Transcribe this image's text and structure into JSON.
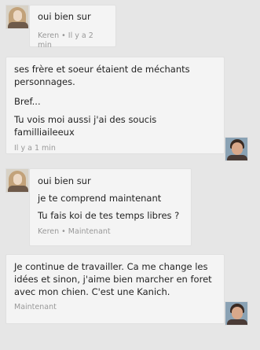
{
  "messages": [
    {
      "sender": "Keren",
      "lines": [
        "oui bien sur"
      ],
      "meta": "Keren • Il y a 2 min",
      "avatar_icon": "keren-avatar-icon"
    },
    {
      "sender": "me",
      "lines": [
        "ses frère et soeur étaient de méchants personnages.",
        "Bref...",
        "Tu vois moi aussi j'ai des soucis familliaileeux"
      ],
      "meta": "Il y a 1 min",
      "avatar_icon": "user-avatar-icon"
    },
    {
      "sender": "Keren",
      "lines": [
        "oui bien sur",
        "je te comprend maintenant",
        "Tu fais koi de tes temps libres ?"
      ],
      "meta": "Keren • Maintenant",
      "avatar_icon": "keren-avatar-icon"
    },
    {
      "sender": "me",
      "lines": [
        "Je continue de travailler. Ca me change les idées et sinon, j'aime bien marcher en foret avec mon chien. C'est une Kanich."
      ],
      "meta": "Maintenant",
      "avatar_icon": "user-avatar-icon"
    }
  ],
  "colors": {
    "bubble_bg": "#f4f4f4",
    "thread_bg": "#e6e6e6",
    "meta_text": "#999999"
  }
}
